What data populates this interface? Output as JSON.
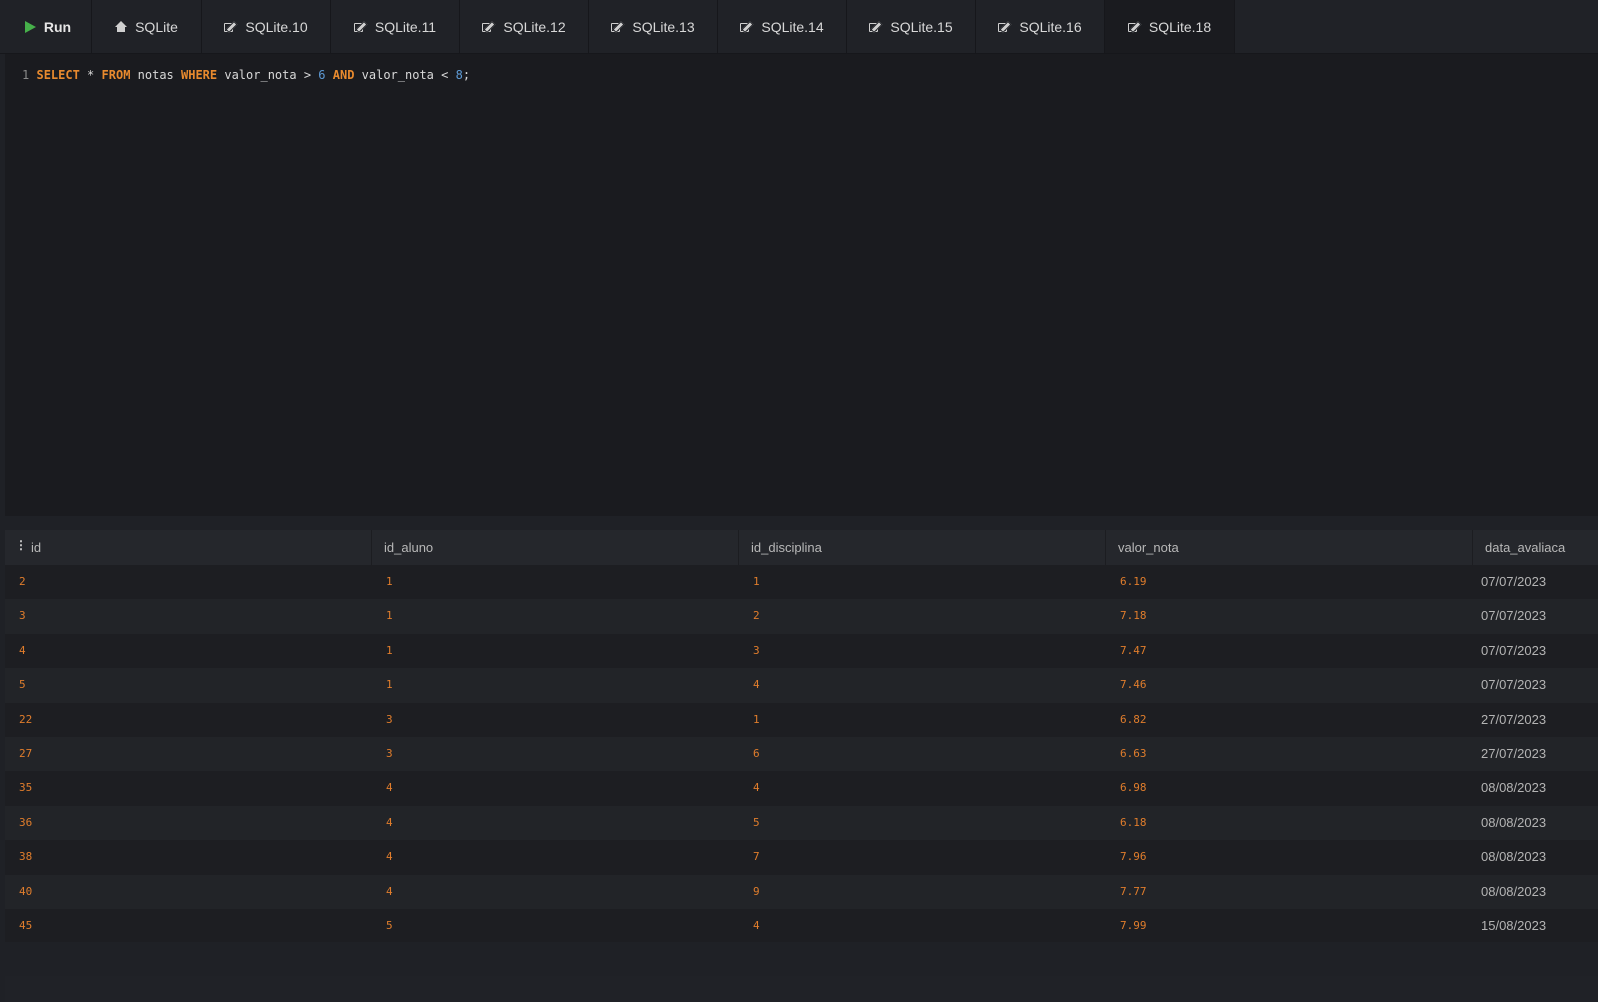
{
  "toolbar": {
    "run_label": "Run",
    "tabs": [
      {
        "label": "SQLite",
        "icon": "home-icon"
      },
      {
        "label": "SQLite.10",
        "icon": "edit-icon"
      },
      {
        "label": "SQLite.11",
        "icon": "edit-icon"
      },
      {
        "label": "SQLite.12",
        "icon": "edit-icon"
      },
      {
        "label": "SQLite.13",
        "icon": "edit-icon"
      },
      {
        "label": "SQLite.14",
        "icon": "edit-icon"
      },
      {
        "label": "SQLite.15",
        "icon": "edit-icon"
      },
      {
        "label": "SQLite.16",
        "icon": "edit-icon"
      },
      {
        "label": "SQLite.18",
        "icon": "edit-icon",
        "active": true
      }
    ]
  },
  "editor": {
    "line_number": "1",
    "tokens": {
      "select": "SELECT",
      "star": " * ",
      "from": "FROM",
      "table": " notas ",
      "where": "WHERE",
      "cond1": " valor_nota > ",
      "num1": "6",
      "sp": " ",
      "and": "AND",
      "cond2": " valor_nota < ",
      "num2": "8",
      "end": ";"
    }
  },
  "results": {
    "columns": [
      "id",
      "id_aluno",
      "id_disciplina",
      "valor_nota",
      "data_avaliaca"
    ],
    "rows": [
      [
        "2",
        "1",
        "1",
        "6.19",
        "07/07/2023"
      ],
      [
        "3",
        "1",
        "2",
        "7.18",
        "07/07/2023"
      ],
      [
        "4",
        "1",
        "3",
        "7.47",
        "07/07/2023"
      ],
      [
        "5",
        "1",
        "4",
        "7.46",
        "07/07/2023"
      ],
      [
        "22",
        "3",
        "1",
        "6.82",
        "27/07/2023"
      ],
      [
        "27",
        "3",
        "6",
        "6.63",
        "27/07/2023"
      ],
      [
        "35",
        "4",
        "4",
        "6.98",
        "08/08/2023"
      ],
      [
        "36",
        "4",
        "5",
        "6.18",
        "08/08/2023"
      ],
      [
        "38",
        "4",
        "7",
        "7.96",
        "08/08/2023"
      ],
      [
        "40",
        "4",
        "9",
        "7.77",
        "08/08/2023"
      ],
      [
        "45",
        "5",
        "4",
        "7.99",
        "15/08/2023"
      ]
    ]
  },
  "colors": {
    "background": "#1f2126",
    "keyword": "#e88a2e",
    "number": "#5e9bd6",
    "cell_value": "#e07d2c",
    "run_icon": "#46b04a"
  }
}
